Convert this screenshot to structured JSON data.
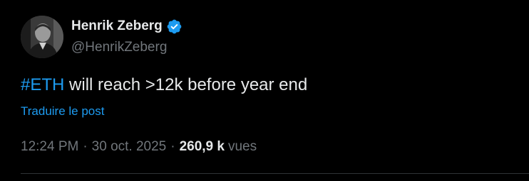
{
  "author": {
    "display_name": "Henrik Zeberg",
    "handle": "@HenrikZeberg",
    "verified_icon": "verified-badge-icon",
    "avatar": "avatar"
  },
  "post": {
    "hashtag": "#ETH",
    "text": " will reach >12k before year end",
    "translate_label": "Traduire le post"
  },
  "meta": {
    "time": "12:24 PM",
    "separator": "·",
    "date": "30 oct. 2025",
    "views_count": "260,9 k",
    "views_label": "vues"
  },
  "colors": {
    "background": "#000000",
    "primary_text": "#e7e9ea",
    "secondary_text": "#71767b",
    "accent": "#1d9bf0",
    "divider": "#2f3336"
  }
}
